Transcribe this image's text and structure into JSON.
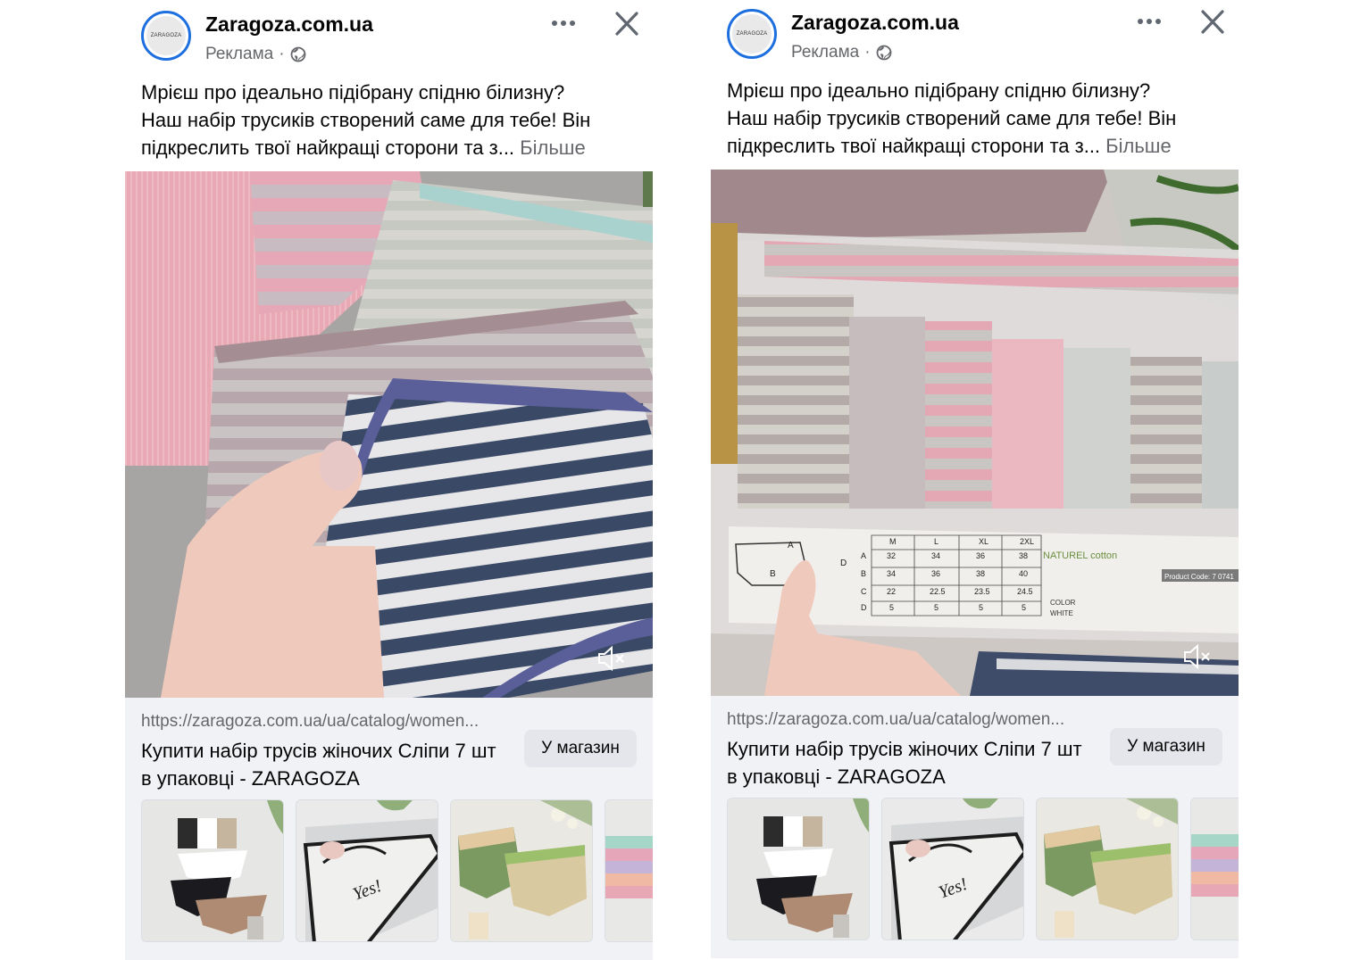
{
  "posts": [
    {
      "page_name": "Zaragoza.com.ua",
      "avatar_text": "ZARAGOZA",
      "sponsored_label": "Реклама",
      "separator": "·",
      "text_lines": [
        "Мрієш про ідеально підібрану спідню білизну?",
        "Наш набір трусиків створений саме для тебе! Він",
        "підкреслить твої найкращі сторони та з..."
      ],
      "see_more": "Більше",
      "link_url": "https://zaragoza.com.ua/ua/catalog/women...",
      "link_title": "Купити набір трусів жіночих Сліпи 7 шт в упаковці - ZARAGOZA",
      "cta_label": "У магазин",
      "thumb_texts": [
        "Yes!"
      ]
    },
    {
      "page_name": "Zaragoza.com.ua",
      "avatar_text": "ZARAGOZA",
      "sponsored_label": "Реклама",
      "separator": "·",
      "text_lines": [
        "Мрієш про ідеально підібрану спідню білизну?",
        "Наш набір трусиків створений саме для тебе! Він",
        "підкреслить твої найкращі сторони та з..."
      ],
      "see_more": "Більше",
      "link_url": "https://zaragoza.com.ua/ua/catalog/women...",
      "link_title": "Купити набір трусів жіночих Сліпи 7 шт в упаковці - ZARAGOZA",
      "cta_label": "У магазин",
      "package_label": {
        "sizes": [
          "M",
          "L",
          "XL",
          "2XL"
        ],
        "rows": [
          {
            "key": "A",
            "values": [
              "32",
              "34",
              "36",
              "38"
            ]
          },
          {
            "key": "B",
            "values": [
              "34",
              "36",
              "38",
              "40"
            ]
          },
          {
            "key": "C",
            "values": [
              "22",
              "22.5",
              "23.5",
              "24.5"
            ]
          },
          {
            "key": "D",
            "values": [
              "5",
              "5",
              "5",
              "5"
            ]
          }
        ],
        "natural_cotton": "NATUREL cotton",
        "color_label": "COLOR",
        "color_value": "WHITE",
        "product_code": "Product Code: 7 0741"
      }
    }
  ],
  "icons": {
    "more": "more-horizontal-icon",
    "close": "close-icon",
    "globe": "globe-icon",
    "mute": "speaker-muted-icon"
  },
  "colors": {
    "avatar_ring": "#1d6fe0",
    "secondary_text": "#65676b",
    "card_bg": "#f0f2f5",
    "button_bg": "#e4e6eb"
  }
}
